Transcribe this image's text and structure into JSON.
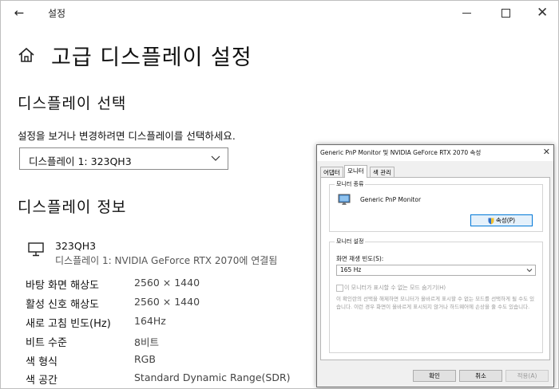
{
  "window": {
    "title": "설정"
  },
  "page": {
    "title": "고급 디스플레이 설정"
  },
  "select_section": {
    "heading": "디스플레이 선택",
    "instruction": "설정을 보거나 변경하려면 디스플레이를 선택하세요.",
    "dropdown_value": "디스플레이 1: 323QH3"
  },
  "info_section": {
    "heading": "디스플레이 정보",
    "monitor_name": "323QH3",
    "monitor_desc": "디스플레이 1: NVIDIA GeForce RTX 2070에 연결됨",
    "rows": [
      {
        "label": "바탕 화면 해상도",
        "value": "2560 × 1440"
      },
      {
        "label": "활성 신호 해상도",
        "value": "2560 × 1440"
      },
      {
        "label": "새로 고침 빈도(Hz)",
        "value": "164Hz"
      },
      {
        "label": "비트 수준",
        "value": "8비트"
      },
      {
        "label": "색 형식",
        "value": "RGB"
      },
      {
        "label": "색 공간",
        "value": "Standard Dynamic Range(SDR)"
      }
    ]
  },
  "dialog": {
    "title": "Generic PnP Monitor 및 NVIDIA GeForce RTX 2070 속성",
    "tabs": [
      "어댑터",
      "모니터",
      "색 관리"
    ],
    "active_tab": "모니터",
    "monitor_type_label": "모니터 종류",
    "monitor_type_name": "Generic PnP Monitor",
    "properties_button": "속성(P)",
    "settings_label": "모니터 설정",
    "refresh_label": "화면 재생 빈도(S):",
    "refresh_value": "165 Hz",
    "hide_modes_label": "이 모니터가 표시할 수 없는 모드 숨기기(H)",
    "hide_modes_desc": "이 확인란의 선택을 해제하면 모니터가 올바르게 표시할 수 없는 모드를 선택하게 될 수도 있습니다. 이런 경우 화면이 올바르게 표시되지 않거나 하드웨어에 손상을 줄 수도 있습니다.",
    "ok_button": "확인",
    "cancel_button": "취소",
    "apply_button": "적용(A)"
  },
  "icons": {
    "back": "back-arrow-icon",
    "home": "home-icon",
    "monitor": "monitor-icon",
    "chevron": "chevron-down-icon",
    "shield": "uac-shield-icon"
  },
  "colors": {
    "accent": "#0078d7",
    "disabled_text": "#9a9a9a",
    "dialog_bg": "#f0f0f0"
  }
}
